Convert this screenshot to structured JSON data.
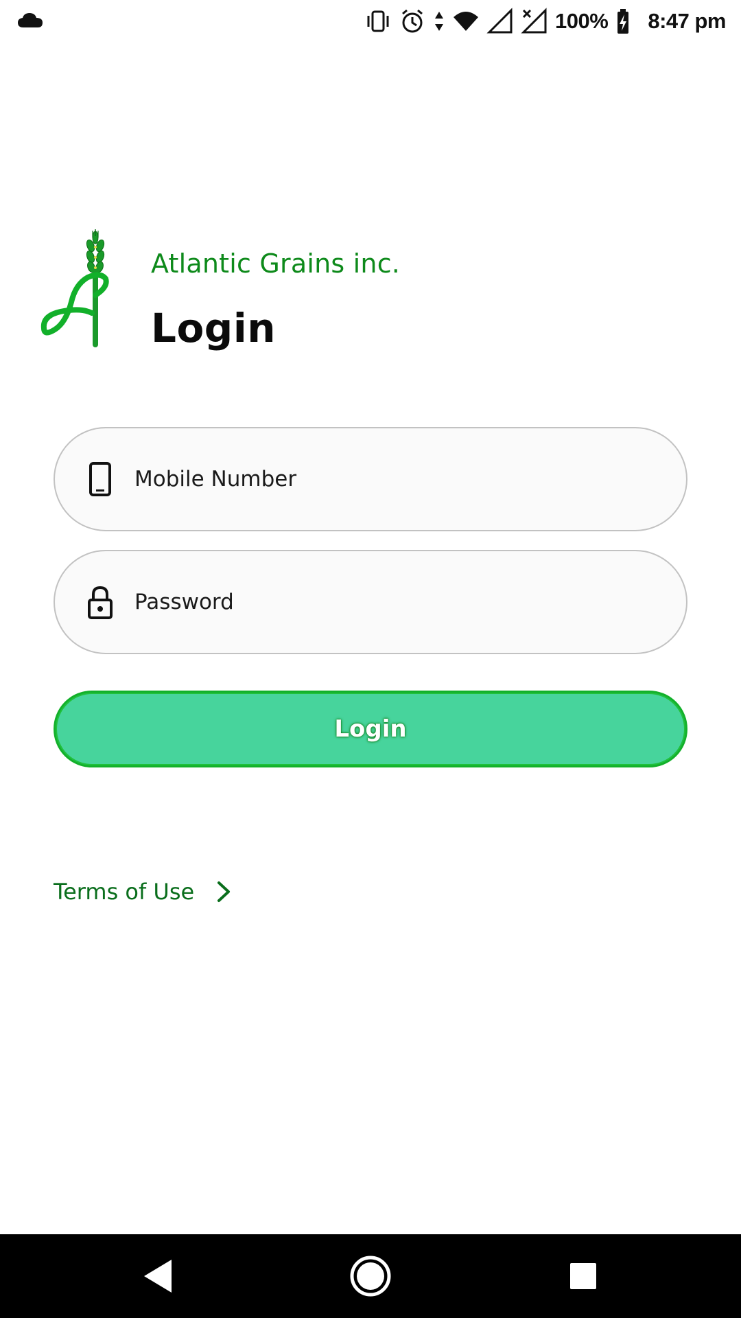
{
  "status_bar": {
    "battery": "100%",
    "time": "8:47 pm",
    "icons": [
      "cloud-icon",
      "vibrate-icon",
      "alarm-icon",
      "data-arrows-icon",
      "wifi-icon",
      "signal-icon",
      "no-signal-icon",
      "battery-charging-icon"
    ]
  },
  "header": {
    "company": "Atlantic Grains inc.",
    "title": "Login",
    "logo_icon": "wheat-logo-icon"
  },
  "form": {
    "mobile": {
      "placeholder": "Mobile Number",
      "value": "",
      "icon": "phone-icon"
    },
    "password": {
      "placeholder": "Password",
      "value": "",
      "icon": "lock-icon"
    },
    "submit_label": "Login"
  },
  "footer": {
    "terms_label": "Terms of Use",
    "terms_icon": "chevron-right-icon"
  },
  "nav": {
    "buttons": [
      "back-icon",
      "home-icon",
      "recents-icon"
    ]
  },
  "colors": {
    "brand_green": "#0e8a1b",
    "button_fill": "#47d49c",
    "button_border": "#12b02a",
    "link_green": "#0a6e1c"
  }
}
